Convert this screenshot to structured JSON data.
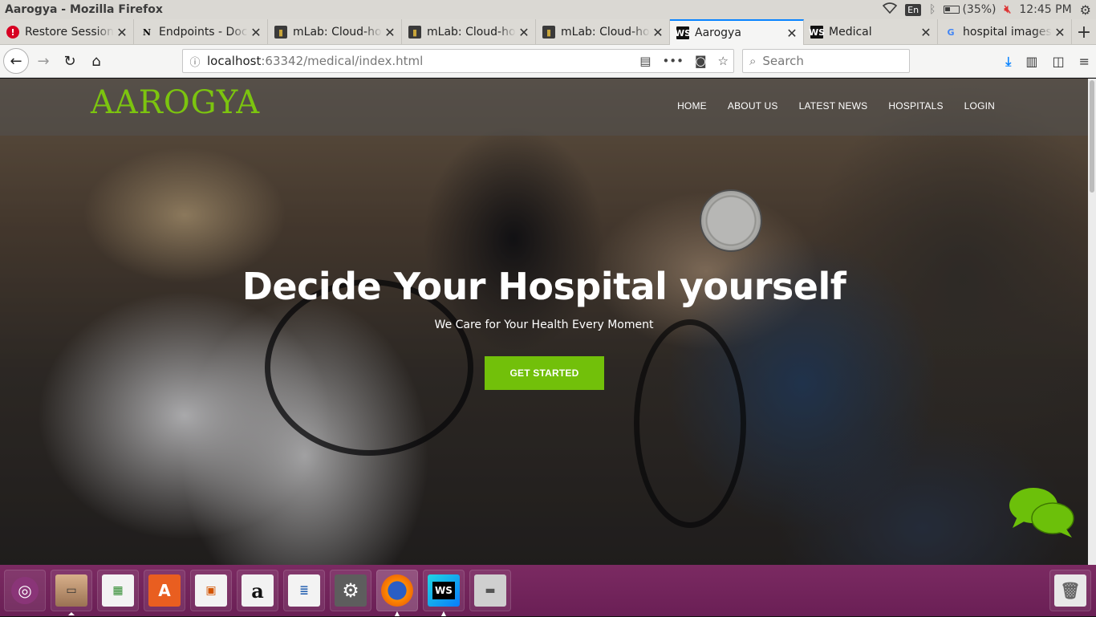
{
  "os_panel": {
    "window_title": "Aarogya - Mozilla Firefox",
    "lang": "En",
    "battery": "(35%)",
    "time": "12:45 PM"
  },
  "tabs": [
    {
      "label": "Restore Session",
      "favicon": "error-icon"
    },
    {
      "label": "Endpoints - Documentation",
      "favicon": "notion-icon"
    },
    {
      "label": "mLab: Cloud-hosted MongoDB",
      "favicon": "mlab-icon"
    },
    {
      "label": "mLab: Cloud-hosted MongoDB",
      "favicon": "mlab-icon"
    },
    {
      "label": "mLab: Cloud-hosted MongoDB",
      "favicon": "mlab-icon"
    },
    {
      "label": "Aarogya",
      "favicon": "webstorm-icon",
      "active": true
    },
    {
      "label": "Medical",
      "favicon": "webstorm-icon"
    },
    {
      "label": "hospital images",
      "favicon": "google-icon"
    }
  ],
  "nav": {
    "url_host": "localhost",
    "url_rest": ":63342/medical/index.html",
    "search_placeholder": "Search"
  },
  "site": {
    "logo": "AAROGYA",
    "menu": [
      "HOME",
      "ABOUT US",
      "LATEST NEWS",
      "HOSPITALS",
      "LOGIN"
    ],
    "hero_title": "Decide Your Hospital yourself",
    "hero_subtitle": "We Care for Your Health Every Moment",
    "cta_label": "GET STARTED"
  },
  "colors": {
    "brand_green": "#72c00a",
    "logo_green": "#7cc40f",
    "dock_purple": "#6a1f55",
    "tab_accent": "#0a84ff"
  },
  "dock": [
    {
      "name": "ubuntu-logo-icon"
    },
    {
      "name": "files-icon"
    },
    {
      "name": "libreoffice-calc-icon"
    },
    {
      "name": "software-center-icon"
    },
    {
      "name": "libreoffice-impress-icon"
    },
    {
      "name": "amazon-icon"
    },
    {
      "name": "libreoffice-writer-icon"
    },
    {
      "name": "system-settings-icon"
    },
    {
      "name": "firefox-icon"
    },
    {
      "name": "webstorm-icon"
    },
    {
      "name": "disk-drive-icon"
    },
    {
      "name": "trash-icon"
    }
  ]
}
